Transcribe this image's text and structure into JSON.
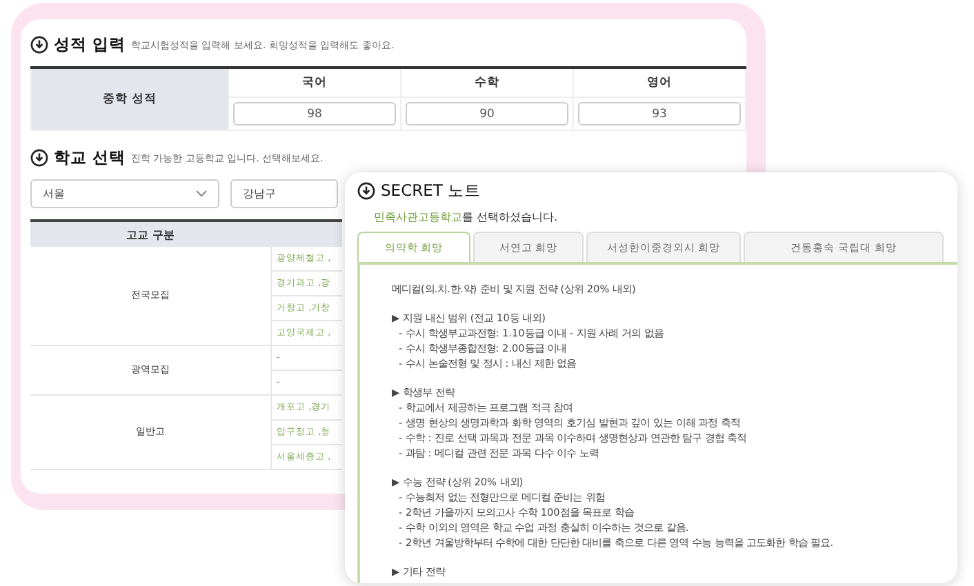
{
  "grades": {
    "title": "성적 입력",
    "hint": "학교시험성적을 입력해 보세요. 희망성적을 입력해도 좋아요.",
    "row_label": "중학 성적",
    "subjects": [
      {
        "name": "국어",
        "value": "98"
      },
      {
        "name": "수학",
        "value": "90"
      },
      {
        "name": "영어",
        "value": "93"
      }
    ]
  },
  "school_select": {
    "title": "학교 선택",
    "hint": "진학 가능한 고등학교 입니다. 선택해보세요.",
    "region": "서울",
    "district": "강남구",
    "table": {
      "columns": [
        "고교 구분"
      ],
      "groups": [
        {
          "category": "전국모집",
          "rows": [
            [
              "광양제철고 ,"
            ],
            [
              "경기과고 ,광"
            ],
            [
              "거창고 ,거창"
            ],
            [
              "고양국제고 ,"
            ]
          ]
        },
        {
          "category": "광역모집",
          "rows": [
            [
              "-"
            ],
            [
              "-"
            ]
          ]
        },
        {
          "category": "일반고",
          "rows": [
            [
              "개포고 ,경기"
            ],
            [
              "압구정고 ,청"
            ],
            [
              "서울세종고 ,"
            ]
          ]
        }
      ]
    }
  },
  "note": {
    "title": "SECRET 노트",
    "school": "민족사관고등학교",
    "selected_suffix": "를 선택하셨습니다.",
    "tabs": [
      {
        "label": "의약학 희망",
        "selected": true
      },
      {
        "label": "서연고 희망",
        "selected": false
      },
      {
        "label": "서성한이중경외시 희망",
        "selected": false
      },
      {
        "label": "건동홍숙 국립대 희망",
        "selected": false
      }
    ],
    "intro": "메디컬(의.치.한.약)  준비 및 지원 전략 (상위 20% 내외)",
    "sections": [
      {
        "heading": "▶ 지원 내신 범위 (전교 10등 내외)",
        "items": [
          "- 수시 학생부교과전형: 1.10등급 이내 - 지원 사례 거의 없음",
          "- 수시 학생부종합전형: 2.00등급 이내",
          "- 수시 논술전형 및 정시 : 내신 제한 없음"
        ]
      },
      {
        "heading": "▶ 학생부 전략",
        "items": [
          "- 학교에서 제공하는 프로그램 적극 참여",
          "- 생명 현상의 생명과학과 화학 영역의 호기심 발현과 깊이 있는 이해 과정 축적",
          "- 수학 : 진로 선택 과목과 전문 과목 이수하며 생명현상과 연관한 탐구 경험 축적",
          "- 과탐 : 메디컬 관련 전문 과목 다수 이수 노력"
        ]
      },
      {
        "heading": "▶ 수능 전략 (상위 20% 내외)",
        "items": [
          "- 수능최저 없는 전형만으로 메디컬 준비는 위험",
          "- 2학년 가을까지 모의고사 수학 100점을 목표로 학습",
          "- 수학 이외의 영역은 학교 수업 과정 충실히 이수하는 것으로 갈음.",
          "- 2학년 겨울방학부터 수학에 대한 단단한 대비를 축으로 다른 영역 수능 능력을 고도화한 학습 필요."
        ]
      },
      {
        "heading": "▶ 기타 전략"
      }
    ]
  }
}
